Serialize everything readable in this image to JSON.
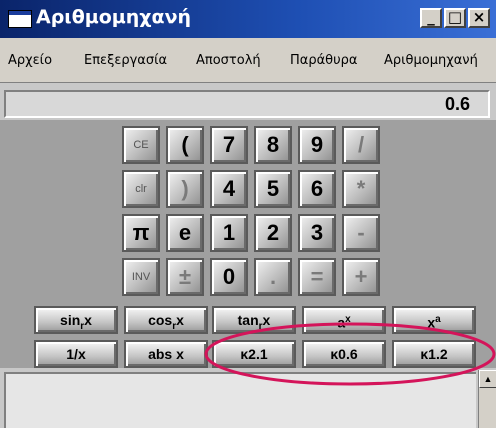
{
  "window": {
    "title": "Αριθμομηχανή",
    "controls": {
      "minimize": "_",
      "maximize": "□",
      "close": "×"
    }
  },
  "menu": [
    "Αρχείο",
    "Επεξεργασία",
    "Αποστολή",
    "Παράθυρα",
    "Αριθμομηχανή"
  ],
  "display": {
    "value": "0.6"
  },
  "keypad": {
    "row1": [
      "CE",
      "(",
      "7",
      "8",
      "9",
      "/"
    ],
    "row2": [
      "clr",
      ")",
      "4",
      "5",
      "6",
      "*"
    ],
    "row3": [
      "π",
      "e",
      "1",
      "2",
      "3",
      "-"
    ],
    "row4": [
      "INV",
      "±",
      "0",
      ".",
      "=",
      "+"
    ]
  },
  "functions": {
    "row1": [
      {
        "base": "sin",
        "sub": "r",
        "tail": "x"
      },
      {
        "base": "cos",
        "sub": "r",
        "tail": "x"
      },
      {
        "base": "tan",
        "sub": "r",
        "tail": "x"
      },
      {
        "base": "a",
        "sup": "x"
      },
      {
        "base": "x",
        "sup": "a"
      }
    ],
    "row2": [
      "1/x",
      "abs x",
      "κ2.1",
      "κ0.6",
      "κ1.2"
    ]
  },
  "colors": {
    "annotation": "#d4145a",
    "title_bar": "#0a246a"
  },
  "scrollbar": {
    "up_arrow": "▲"
  }
}
